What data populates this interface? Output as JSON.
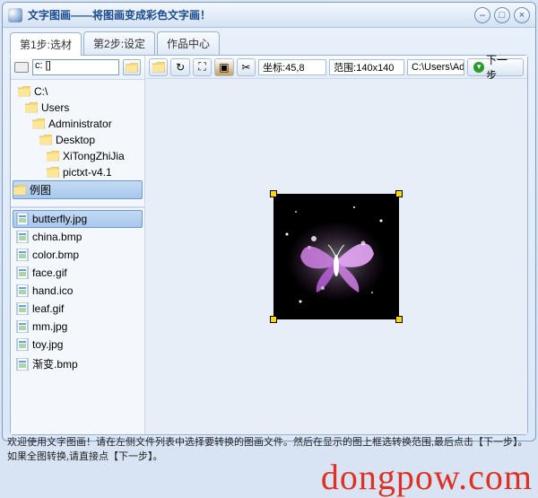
{
  "window": {
    "title": "文字图画——将图画变成彩色文字画！"
  },
  "tabs": [
    {
      "label": "第1步:选材",
      "active": true
    },
    {
      "label": "第2步:设定",
      "active": false
    },
    {
      "label": "作品中心",
      "active": false
    }
  ],
  "drive": {
    "selected": "c: []"
  },
  "tree": [
    {
      "label": "C:\\",
      "indent": 1
    },
    {
      "label": "Users",
      "indent": 2
    },
    {
      "label": "Administrator",
      "indent": 3
    },
    {
      "label": "Desktop",
      "indent": 4
    },
    {
      "label": "XiTongZhiJia",
      "indent": 5
    },
    {
      "label": "pictxt-v4.1",
      "indent": 5
    },
    {
      "label": "例图",
      "indent": 6,
      "selected": true
    }
  ],
  "files": [
    {
      "name": "butterfly.jpg",
      "selected": true
    },
    {
      "name": "china.bmp"
    },
    {
      "name": "color.bmp"
    },
    {
      "name": "face.gif"
    },
    {
      "name": "hand.ico"
    },
    {
      "name": "leaf.gif"
    },
    {
      "name": "mm.jpg"
    },
    {
      "name": "toy.jpg"
    },
    {
      "name": "渐变.bmp"
    }
  ],
  "toolbar": {
    "coord_label": "坐标:45,8",
    "range_label": "范围:140x140",
    "path": "C:\\Users\\Adr",
    "next_label": "下一步"
  },
  "status": {
    "text": "欢迎使用文字图画！请在左侧文件列表中选择要转换的图画文件。然后在显示的图上框选转换范围,最后点击【下一步】。如果全图转换,请直接点【下一步】。"
  },
  "watermark": {
    "text": "dongpow.com"
  }
}
